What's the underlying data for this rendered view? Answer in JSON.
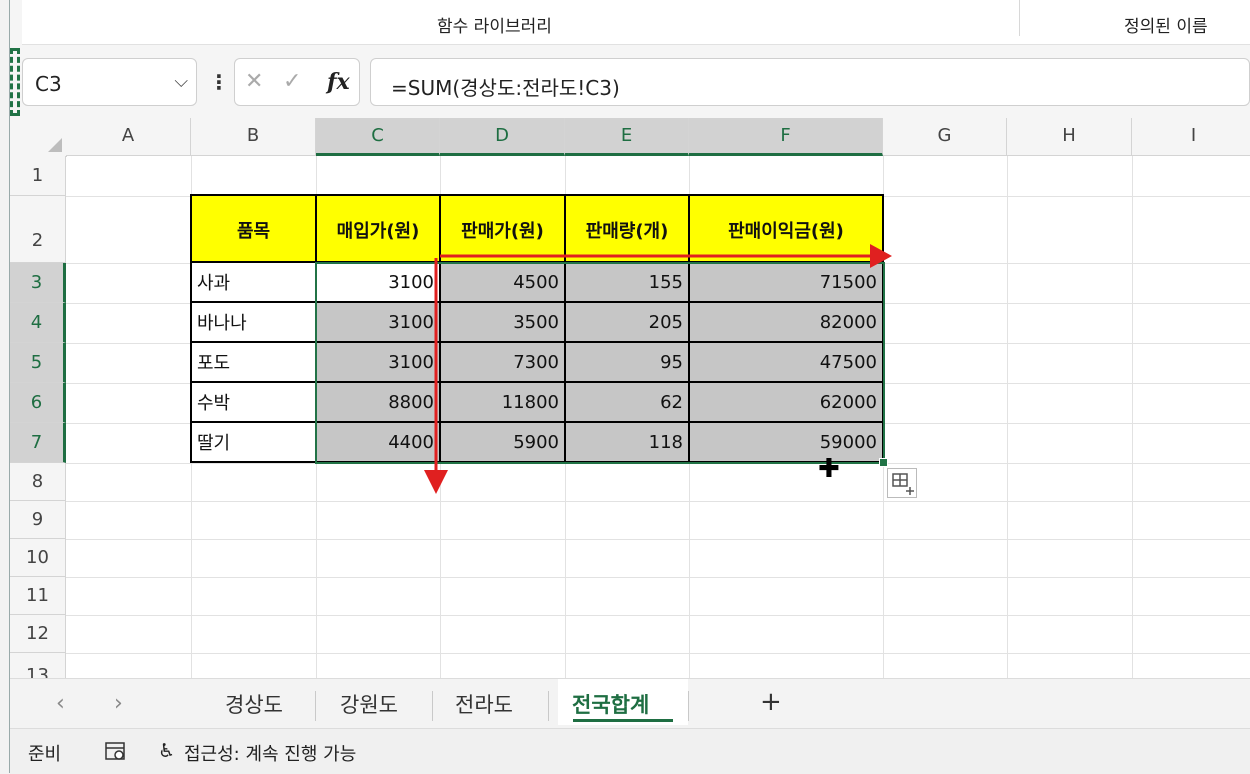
{
  "ribbon": {
    "group1": "함수 라이브러리",
    "group2": "정의된 이름"
  },
  "formula_bar": {
    "name_box": "C3",
    "cancel": "✕",
    "enter": "✓",
    "fx": "fx",
    "formula": "=SUM(경상도:전라도!C3)"
  },
  "columns": [
    "A",
    "B",
    "C",
    "D",
    "E",
    "F",
    "G",
    "H",
    "I"
  ],
  "rows": [
    "1",
    "2",
    "3",
    "4",
    "5",
    "6",
    "7",
    "8",
    "9",
    "10",
    "11",
    "12",
    "13"
  ],
  "table": {
    "headers": [
      "품목",
      "매입가(원)",
      "판매가(원)",
      "판매량(개)",
      "판매이익금(원)"
    ],
    "rows": [
      [
        "사과",
        "3100",
        "4500",
        "155",
        "71500"
      ],
      [
        "바나나",
        "3100",
        "3500",
        "205",
        "82000"
      ],
      [
        "포도",
        "3100",
        "7300",
        "95",
        "47500"
      ],
      [
        "수박",
        "8800",
        "11800",
        "62",
        "62000"
      ],
      [
        "딸기",
        "4400",
        "5900",
        "118",
        "59000"
      ]
    ]
  },
  "sheet_tabs": {
    "prev": "‹",
    "next": "›",
    "tabs": [
      "경상도",
      "강원도",
      "전라도",
      "전국합계"
    ],
    "active_index": 3,
    "add": "+"
  },
  "status_bar": {
    "ready": "준비",
    "accessibility": "접근성: 계속 진행 가능"
  },
  "colors": {
    "header_fill": "#ffff00",
    "selection": "#217346",
    "arrow": "#e02020",
    "selected_fill": "#c6c6c6"
  }
}
